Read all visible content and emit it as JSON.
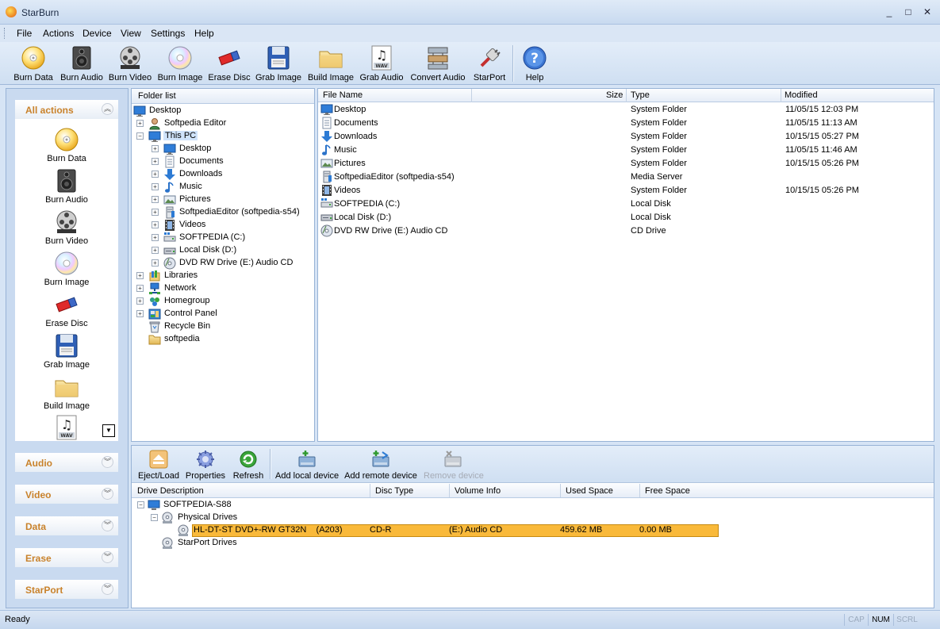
{
  "window": {
    "title": "StarBurn",
    "minimize": "_",
    "maximize": "□",
    "close": "✕"
  },
  "menu": [
    "File",
    "Actions",
    "Device",
    "View",
    "Settings",
    "Help"
  ],
  "toolbar": [
    "Burn Data",
    "Burn Audio",
    "Burn Video",
    "Burn Image",
    "Erase Disc",
    "Grab Image",
    "Build Image",
    "Grab Audio",
    "Convert Audio",
    "StarPort",
    "Help"
  ],
  "left_panel": {
    "header": "All actions",
    "actions": [
      "Burn Data",
      "Burn Audio",
      "Burn Video",
      "Burn Image",
      "Erase Disc",
      "Grab Image",
      "Build Image"
    ],
    "groups": [
      "Audio",
      "Video",
      "Data",
      "Erase",
      "StarPort"
    ]
  },
  "folder_panel": {
    "header": "Folder list",
    "tree": [
      "Desktop",
      "Softpedia Editor",
      "This PC",
      "Desktop",
      "Documents",
      "Downloads",
      "Music",
      "Pictures",
      "SoftpediaEditor (softpedia-s54)",
      "Videos",
      "SOFTPEDIA (C:)",
      "Local Disk (D:)",
      "DVD RW Drive (E:) Audio CD",
      "Libraries",
      "Network",
      "Homegroup",
      "Control Panel",
      "Recycle Bin",
      "softpedia"
    ]
  },
  "file_list": {
    "columns": [
      "File Name",
      "Size",
      "Type",
      "Modified"
    ],
    "rows": [
      {
        "name": "Desktop",
        "type": "System Folder",
        "modified": "11/05/15 12:03 PM"
      },
      {
        "name": "Documents",
        "type": "System Folder",
        "modified": "11/05/15 11:13 AM"
      },
      {
        "name": "Downloads",
        "type": "System Folder",
        "modified": "10/15/15 05:27 PM"
      },
      {
        "name": "Music",
        "type": "System Folder",
        "modified": "11/05/15 11:46 AM"
      },
      {
        "name": "Pictures",
        "type": "System Folder",
        "modified": "10/15/15 05:26 PM"
      },
      {
        "name": "SoftpediaEditor (softpedia-s54)",
        "type": "Media Server",
        "modified": ""
      },
      {
        "name": "Videos",
        "type": "System Folder",
        "modified": "10/15/15 05:26 PM"
      },
      {
        "name": "SOFTPEDIA (C:)",
        "type": "Local Disk",
        "modified": ""
      },
      {
        "name": "Local Disk (D:)",
        "type": "Local Disk",
        "modified": ""
      },
      {
        "name": "DVD RW Drive (E:) Audio CD",
        "type": "CD Drive",
        "modified": ""
      }
    ]
  },
  "device_panel": {
    "buttons": [
      "Eject/Load",
      "Properties",
      "Refresh",
      "Add local device",
      "Add remote device",
      "Remove device"
    ],
    "columns": [
      "Drive Description",
      "Disc Type",
      "Volume Info",
      "Used Space",
      "Free Space"
    ],
    "computer": "SOFTPEDIA-S88",
    "physical_drives": "Physical Drives",
    "drive": {
      "description": "HL-DT-ST DVD+-RW GT32N    (A203)",
      "disc_type": "CD-R",
      "volume_info": "(E:) Audio CD",
      "used": "459.62 MB",
      "free": "0.00 MB"
    },
    "starport_drives": "StarPort Drives"
  },
  "status": {
    "text": "Ready",
    "cap": "CAP",
    "num": "NUM",
    "scrl": "SCRL"
  }
}
